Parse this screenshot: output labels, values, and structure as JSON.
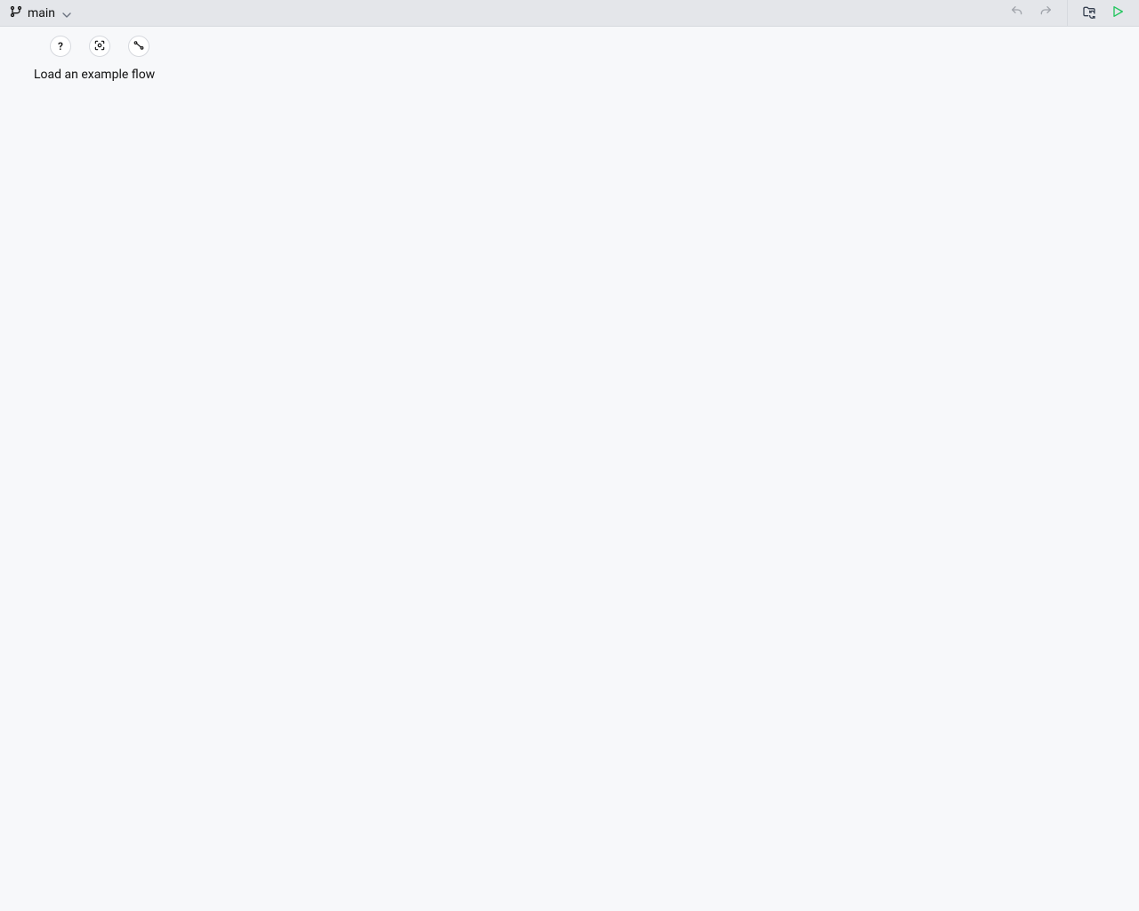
{
  "header": {
    "branch_label": "main"
  },
  "toolbar": {
    "hint_text": "Load an example flow",
    "help_glyph": "?"
  }
}
